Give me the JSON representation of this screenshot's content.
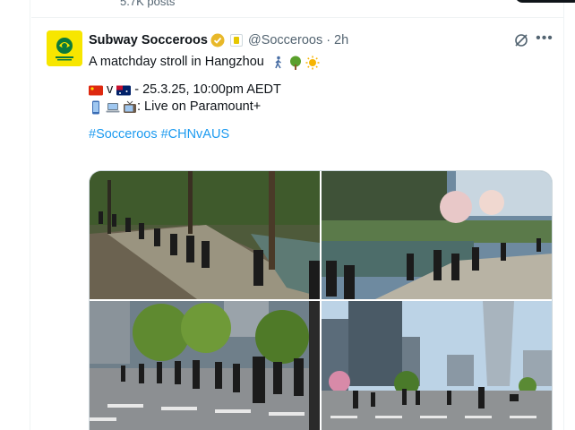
{
  "previous_tweet": {
    "truncated_text": "5.7K posts"
  },
  "tweet": {
    "author": {
      "display_name": "Subway Socceroos",
      "handle": "@Socceroos",
      "separator": "·",
      "time": "2h",
      "avatar_text": "SOCCEROOS",
      "avatar_color": "#f7e600"
    },
    "body": {
      "line1": "A matchday stroll in Hangzhou",
      "line1_emojis": [
        "walking-person",
        "deciduous-tree",
        "sun"
      ],
      "line2_vs": "v",
      "line2_text": "- 25.3.25, 10:00pm AEDT",
      "line2_flags": [
        "china-flag",
        "australia-flag"
      ],
      "line3_text": ": Live on Paramount+",
      "line3_emojis": [
        "mobile-phone",
        "laptop",
        "television"
      ],
      "hashtags": [
        "#Socceroos",
        "#CHNvAUS"
      ]
    },
    "media": [
      "park-walk-photo",
      "river-walk-photo",
      "street-crossing-photo",
      "city-skyline-photo"
    ],
    "colors": {
      "link": "#1d9bf0",
      "verified": "#e8b829",
      "text": "#0f1419",
      "muted": "#536471"
    }
  }
}
